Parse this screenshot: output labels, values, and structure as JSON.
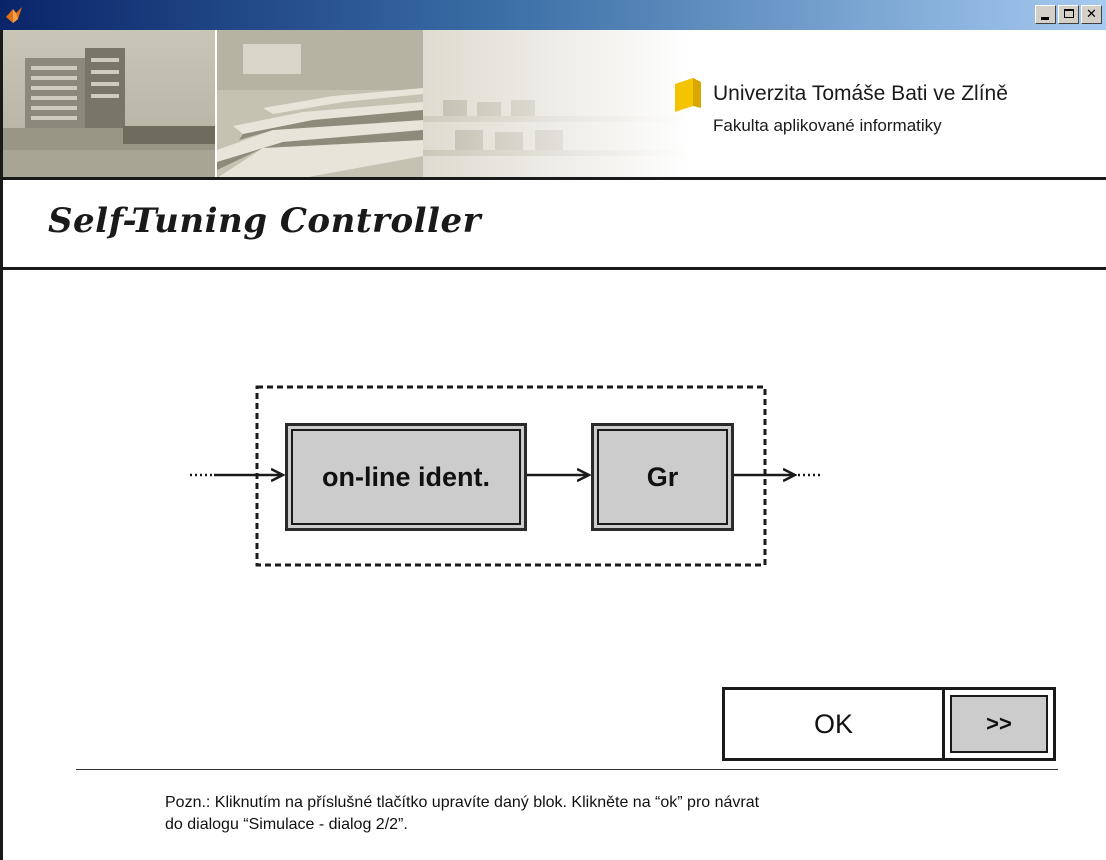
{
  "window": {
    "controls": {
      "minimize": "minimize-icon",
      "maximize": "maximize-icon",
      "close": "close-icon"
    }
  },
  "banner": {
    "university_name": "Univerzita Tomáše Bati ve Zlíně",
    "faculty_name": "Fakulta aplikované informatiky",
    "logo_color": "#f5c400"
  },
  "header": {
    "title": "Self-Tuning Controller"
  },
  "diagram": {
    "blocks": [
      {
        "label": "on-line ident."
      },
      {
        "label": "Gr"
      }
    ]
  },
  "actions": {
    "ok_label": "OK",
    "more_label": ">>"
  },
  "note": {
    "line1": "Pozn.: Kliknutím na příslušné tlačítko upravíte daný blok. Klikněte na “ok” pro návrat",
    "line2": "do dialogu “Simulace - dialog 2/2”."
  },
  "colors": {
    "titlebar_start": "#0a246a",
    "titlebar_end": "#a6caf0",
    "block_fill": "#cccccc",
    "line": "#1a1a1a"
  }
}
